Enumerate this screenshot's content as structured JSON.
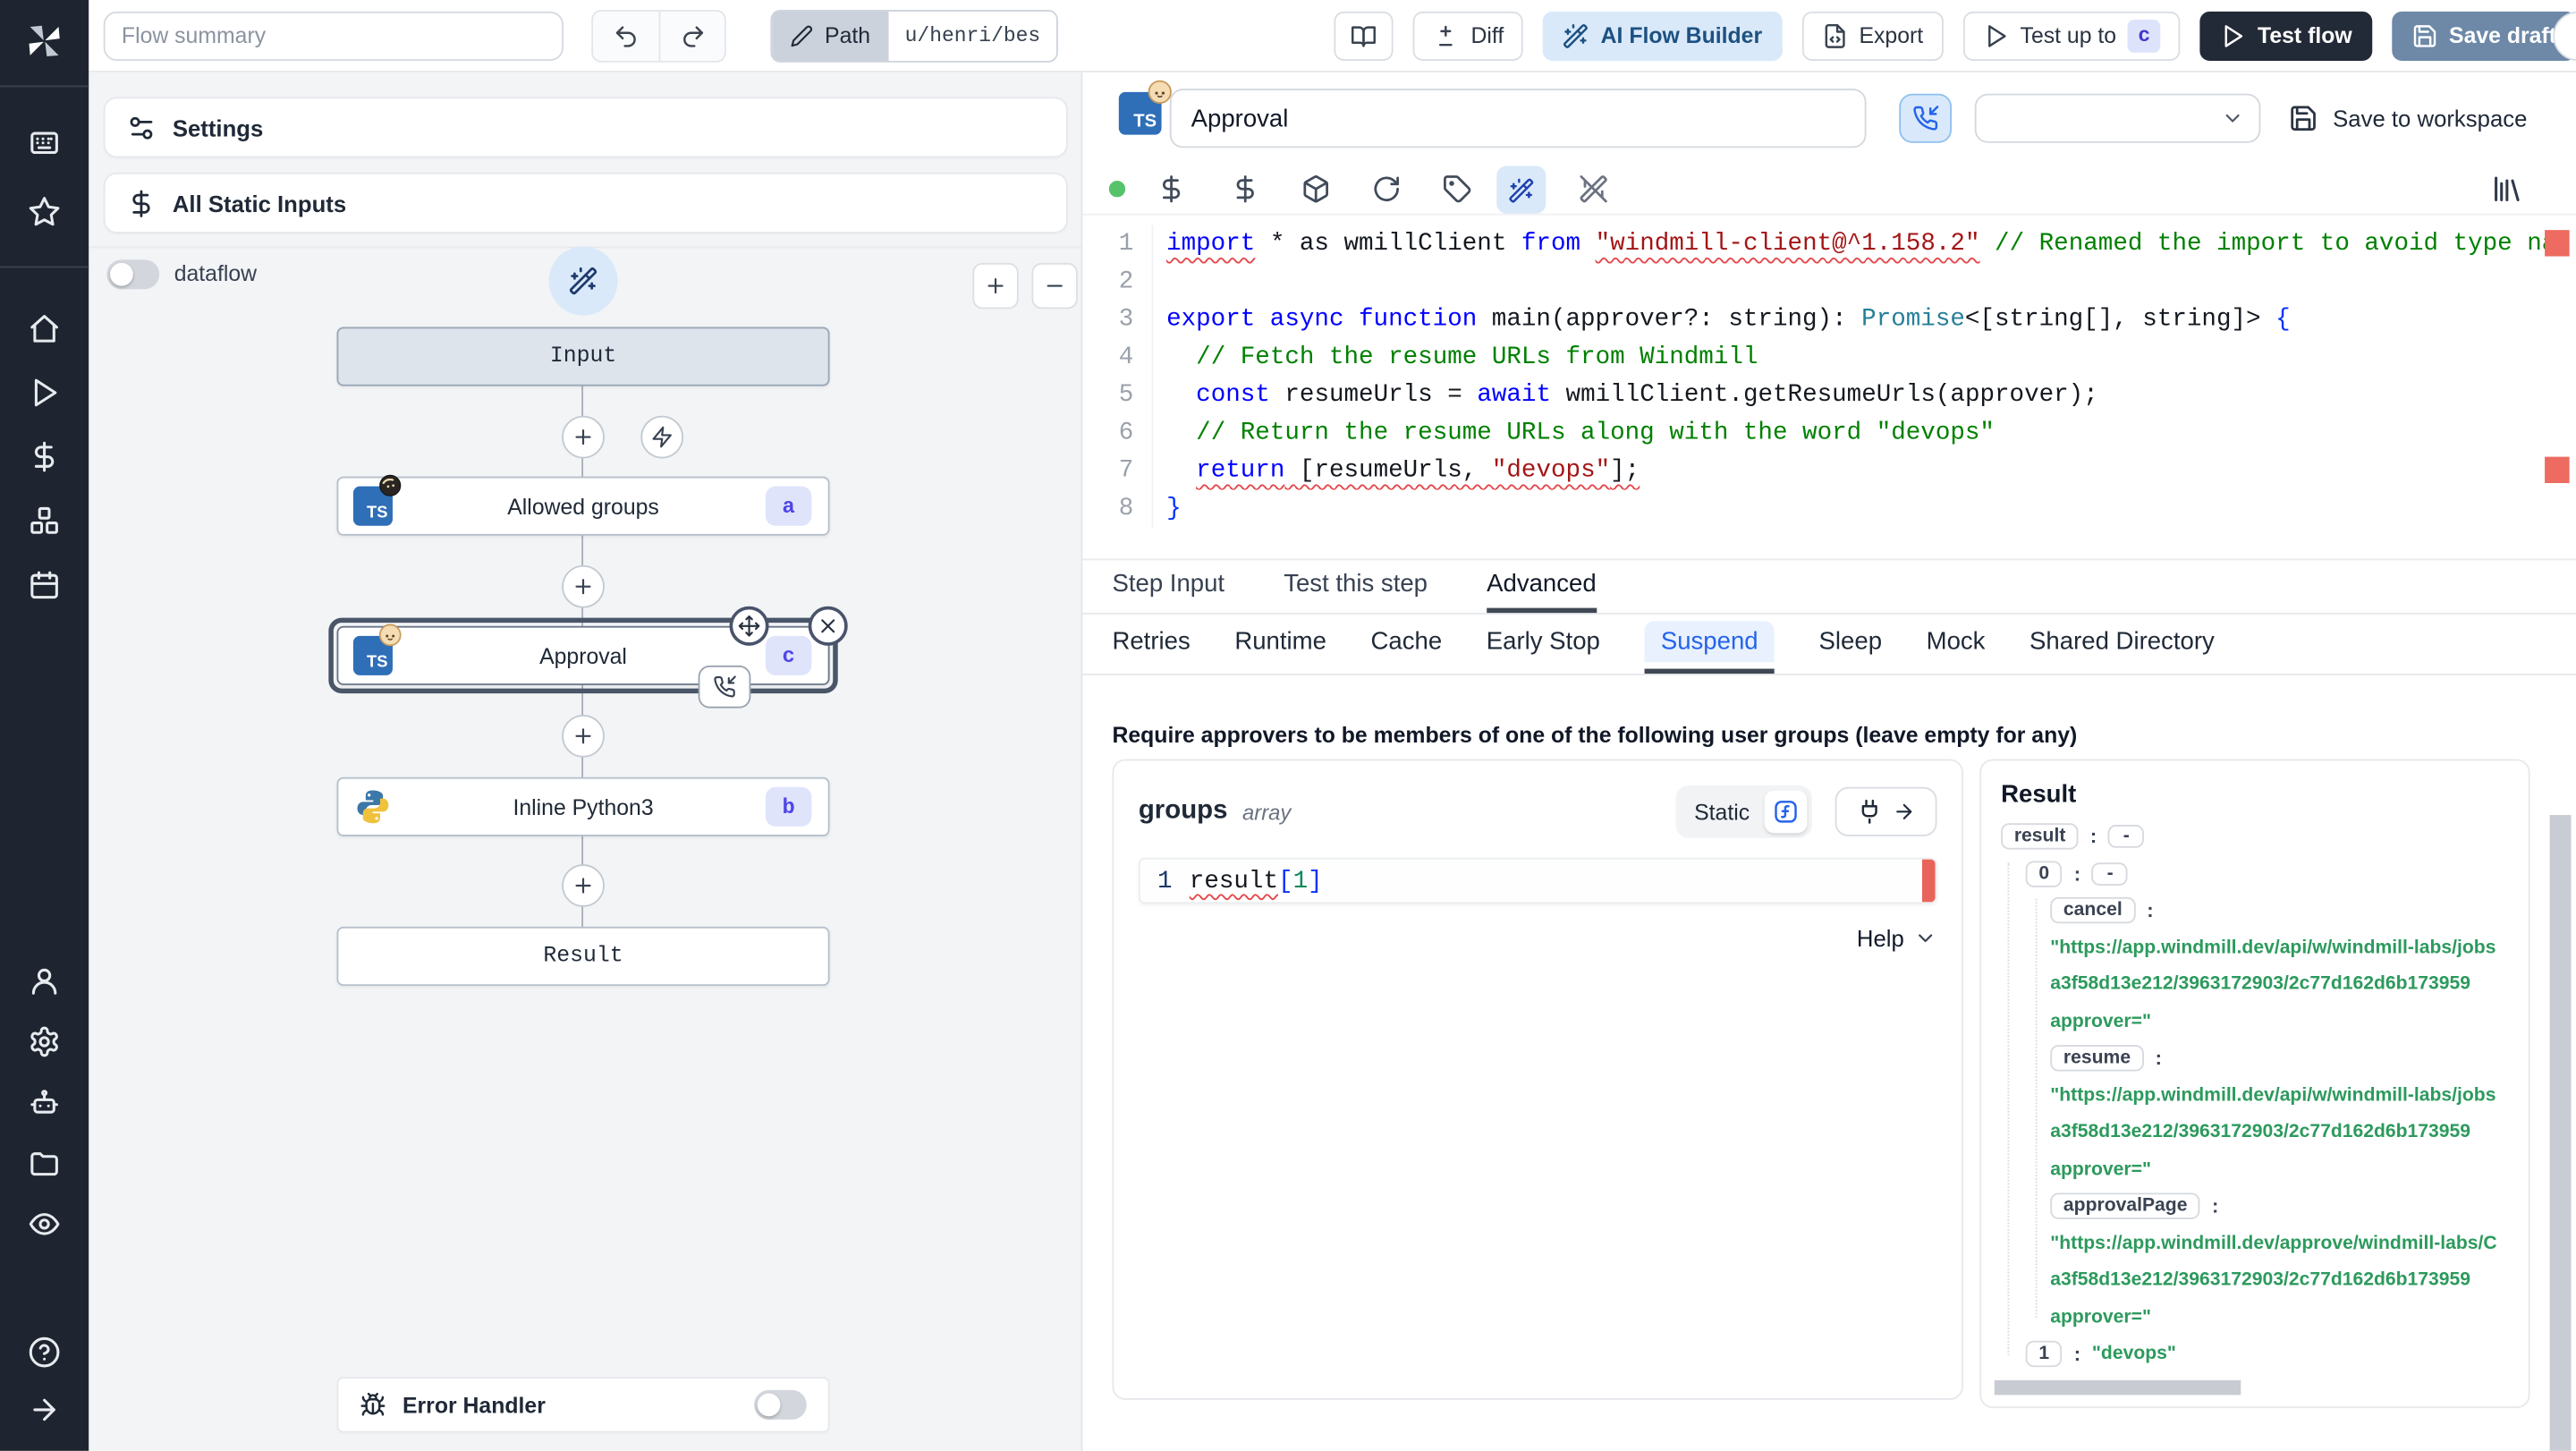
{
  "topbar": {
    "flow_summary_placeholder": "Flow summary",
    "path_label": "Path",
    "path_value": "u/henri/bes",
    "diff_label": "Diff",
    "ai_builder_label": "AI Flow Builder",
    "export_label": "Export",
    "test_up_to_label": "Test up to",
    "test_up_to_badge": "c",
    "test_flow_label": "Test flow",
    "save_draft_label": "Save draft"
  },
  "sidebar": {
    "top_icons": [
      "apps",
      "star"
    ],
    "mid_icons": [
      "home",
      "play",
      "dollar",
      "cubes",
      "calendar"
    ],
    "bottom_icons": [
      "user",
      "gear",
      "bot",
      "folder",
      "eye"
    ],
    "foot_icons": [
      "help",
      "arrow-right"
    ]
  },
  "flow_panel": {
    "settings_label": "Settings",
    "static_inputs_label": "All Static Inputs",
    "dataflow_label": "dataflow",
    "zoom_in_label": "+",
    "zoom_out_label": "−"
  },
  "graph": {
    "input_label": "Input",
    "result_label": "Result",
    "error_handler_label": "Error Handler",
    "steps": [
      {
        "label": "Allowed groups",
        "badge": "a",
        "lang": "typescript"
      },
      {
        "label": "Approval",
        "badge": "c",
        "lang": "typescript",
        "selected": true
      },
      {
        "label": "Inline Python3",
        "badge": "b",
        "lang": "python"
      }
    ]
  },
  "step_editor": {
    "name_value": "Approval",
    "save_to_workspace_label": "Save to workspace",
    "toolbar_icons": [
      "dollar",
      "dollar",
      "package",
      "refresh",
      "tag"
    ],
    "colors": {
      "accent_blue": "#2563eb",
      "ai_chip_bg": "#d9e9f9",
      "test_flow_bg": "#232a37",
      "save_draft_bg": "#6d89a7",
      "badge_bg": "#dfe4fb",
      "badge_text": "#4f46e5",
      "result_string_green": "#2c9a5d",
      "error_red": "#e8645a",
      "status_dot_green": "#56c36b"
    }
  },
  "code": {
    "lines": [
      {
        "n": "1",
        "segs": [
          {
            "t": "import",
            "c": "kw sq"
          },
          {
            "t": " * as wmillClient ",
            "c": "pl"
          },
          {
            "t": "from",
            "c": "kw"
          },
          {
            "t": " ",
            "c": "pl"
          },
          {
            "t": "\"windmill-client@^1.158.2\"",
            "c": "str sq"
          },
          {
            "t": " ",
            "c": "pl"
          },
          {
            "t": "// Renamed the import to avoid type na",
            "c": "com"
          }
        ]
      },
      {
        "n": "2",
        "segs": []
      },
      {
        "n": "3",
        "segs": [
          {
            "t": "export async function",
            "c": "kw"
          },
          {
            "t": " main(approver?: string): ",
            "c": "pl"
          },
          {
            "t": "Promise",
            "c": "ty"
          },
          {
            "t": "<[string[], string]> ",
            "c": "pl"
          },
          {
            "t": "{",
            "c": "br"
          }
        ]
      },
      {
        "n": "4",
        "segs": [
          {
            "t": "  ",
            "c": "pl"
          },
          {
            "t": "// Fetch the resume URLs from Windmill",
            "c": "com"
          }
        ]
      },
      {
        "n": "5",
        "segs": [
          {
            "t": "  ",
            "c": "pl"
          },
          {
            "t": "const",
            "c": "kw"
          },
          {
            "t": " resumeUrls = ",
            "c": "pl"
          },
          {
            "t": "await",
            "c": "kw"
          },
          {
            "t": " wmillClient.getResumeUrls(approver);",
            "c": "pl"
          }
        ]
      },
      {
        "n": "6",
        "segs": [
          {
            "t": "  ",
            "c": "pl"
          },
          {
            "t": "// Return the resume URLs along with the word \"devops\"",
            "c": "com"
          }
        ]
      },
      {
        "n": "7",
        "segs": [
          {
            "t": "  ",
            "c": "pl"
          },
          {
            "t": "return",
            "c": "kw sq"
          },
          {
            "t": " [resumeUrls, ",
            "c": "pl sq"
          },
          {
            "t": "\"devops\"",
            "c": "str sq"
          },
          {
            "t": "];",
            "c": "pl sq"
          }
        ]
      },
      {
        "n": "8",
        "segs": [
          {
            "t": "}",
            "c": "br"
          }
        ]
      }
    ]
  },
  "tabs": {
    "main": [
      {
        "label": "Step Input"
      },
      {
        "label": "Test this step"
      },
      {
        "label": "Advanced",
        "active": true
      }
    ],
    "advanced": [
      {
        "label": "Retries"
      },
      {
        "label": "Runtime"
      },
      {
        "label": "Cache"
      },
      {
        "label": "Early Stop"
      },
      {
        "label": "Suspend",
        "active": true
      },
      {
        "label": "Sleep"
      },
      {
        "label": "Mock"
      },
      {
        "label": "Shared Directory"
      }
    ]
  },
  "suspend": {
    "heading": "Require approvers to be members of one of the following user groups (leave empty for any)",
    "groups_label": "groups",
    "groups_type": "array",
    "static_label": "Static",
    "expr_line_number": "1",
    "expr_segs": [
      {
        "t": "result",
        "c": "pl sq"
      },
      {
        "t": "[",
        "c": "br"
      },
      {
        "t": "1",
        "c": "num"
      },
      {
        "t": "]",
        "c": "br"
      }
    ],
    "help_label": "Help"
  },
  "result_panel": {
    "title": "Result",
    "rows": [
      {
        "indent": 0,
        "key": "result",
        "collapse": "-"
      },
      {
        "indent": 1,
        "key": "0",
        "collapse": "-"
      },
      {
        "indent": 2,
        "key": "cancel"
      },
      {
        "indent": 2,
        "green": "\"https://app.windmill.dev/api/w/windmill-labs/jobs"
      },
      {
        "indent": 2,
        "green": "a3f58d13e212/3963172903/2c77d162d6b173959"
      },
      {
        "indent": 2,
        "green": "approver=\""
      },
      {
        "indent": 2,
        "key": "resume"
      },
      {
        "indent": 2,
        "green": "\"https://app.windmill.dev/api/w/windmill-labs/jobs"
      },
      {
        "indent": 2,
        "green": "a3f58d13e212/3963172903/2c77d162d6b173959"
      },
      {
        "indent": 2,
        "green": "approver=\""
      },
      {
        "indent": 2,
        "key": "approvalPage"
      },
      {
        "indent": 2,
        "green": "\"https://app.windmill.dev/approve/windmill-labs/C"
      },
      {
        "indent": 2,
        "green": "a3f58d13e212/3963172903/2c77d162d6b173959"
      },
      {
        "indent": 2,
        "green": "approver=\""
      },
      {
        "indent": 1,
        "key": "1",
        "green": "\"devops\""
      }
    ]
  }
}
